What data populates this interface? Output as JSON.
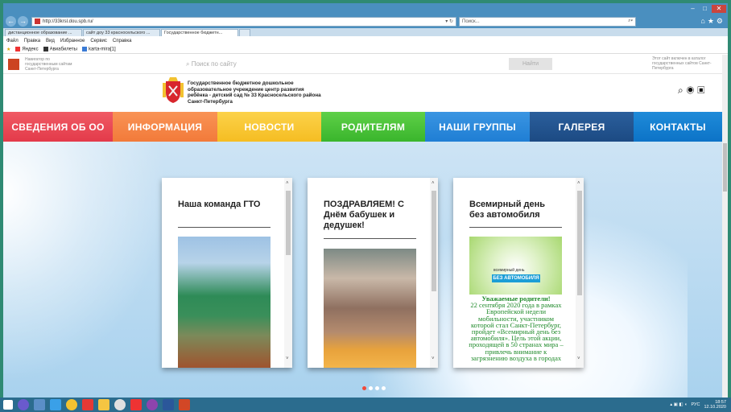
{
  "browser": {
    "url": "http://33krsl.dou.spb.ru/",
    "search_placeholder": "Поиск...",
    "tabs": [
      {
        "label": "дистанционное образование ..."
      },
      {
        "label": "сайт доу 33 красносельского ..."
      },
      {
        "label": "Государственное бюджетн..."
      }
    ],
    "menu": [
      "Файл",
      "Правка",
      "Вид",
      "Избранное",
      "Сервис",
      "Справка"
    ],
    "favorites": [
      "Яндекс",
      "Авиабилеты",
      "karta-mira[1]"
    ]
  },
  "top_strip": {
    "navigator_text": "Навигатор по государственным сайтам Санкт-Петербурга",
    "search_placeholder": "Поиск по сайту",
    "find_button": "Найти",
    "catalog_note": "Этот сайт включен в каталог государственных сайтов Санкт-Петербурга"
  },
  "header": {
    "org_name": "Государственное бюджетное дошкольное образовательное учреждение центр развития ребёнка - детский сад № 33 Красносельского района Санкт-Петербурга"
  },
  "nav": [
    {
      "label": "СВЕДЕНИЯ ОБ ОО"
    },
    {
      "label": "ИНФОРМАЦИЯ"
    },
    {
      "label": "НОВОСТИ"
    },
    {
      "label": "РОДИТЕЛЯМ"
    },
    {
      "label": "НАШИ ГРУППЫ"
    },
    {
      "label": "ГАЛЕРЕЯ"
    },
    {
      "label": "КОНТАКТЫ"
    }
  ],
  "cards": [
    {
      "title": "Наша команда ГТО"
    },
    {
      "title": "ПОЗДРАВЛЯЕМ! С Днём бабушек и дедушек!"
    },
    {
      "title": "Всемирный день без автомобиля",
      "image_caption_small": "всемирный день",
      "image_caption_big": "БЕЗ АВТОМОБИЛЯ",
      "body_heading": "Уважаемые родители!",
      "body": "22 сентября 2020 года в рамках Европейской недели мобильности, участником которой стал Санкт-Петербург, пройдет «Всемирный день без автомобиля». Цель этой акции, проходящей в 50 странах мира – привлечь внимание к загрязнению воздуха в городах"
    }
  ],
  "carousel": {
    "active_index": 0,
    "count": 4
  },
  "system": {
    "lang": "РУС",
    "time": "18:57",
    "date": "12.10.2020"
  }
}
